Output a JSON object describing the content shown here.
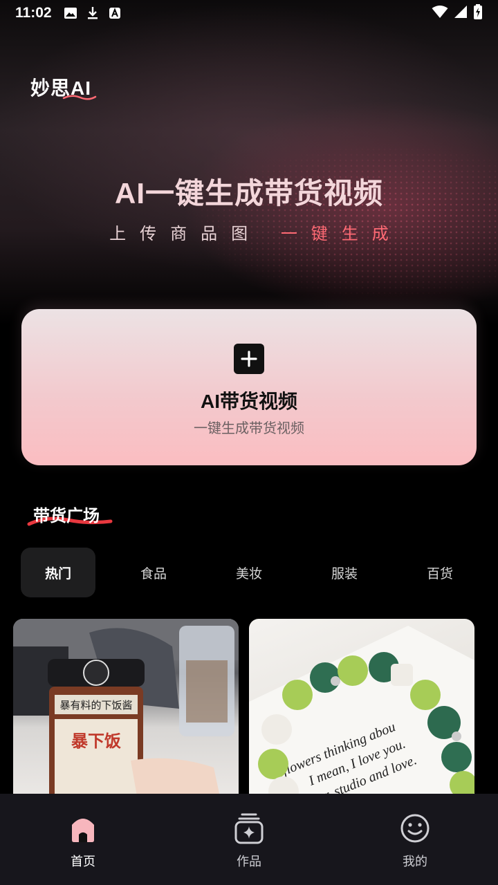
{
  "status_bar": {
    "time": "11:02"
  },
  "app": {
    "logo": "妙思AI"
  },
  "hero": {
    "title": "AI一键生成带货视频",
    "subtitle_part1": "上传商品图",
    "subtitle_part2": "一键生成"
  },
  "create_card": {
    "title": "AI带货视频",
    "subtitle": "一键生成带货视频"
  },
  "plaza": {
    "title": "带货广场",
    "tabs": [
      "热门",
      "食品",
      "美妆",
      "服装",
      "百货"
    ],
    "active_tab": "热门",
    "products": [
      {
        "image_label": "暴有料的下饭酱",
        "brand": "暴下饭"
      },
      {
        "image_text_lines": [
          "flowers thinking abou",
          "I mean, I love you.",
          "ower, studio and love."
        ]
      }
    ]
  },
  "bottom_nav": {
    "items": [
      {
        "label": "首页",
        "icon": "home-icon",
        "active": true
      },
      {
        "label": "作品",
        "icon": "works-icon",
        "active": false
      },
      {
        "label": "我的",
        "icon": "profile-smile-icon",
        "active": false
      }
    ]
  },
  "colors": {
    "accent_red": "#ff6a74",
    "card_pink": "#fbbdc1",
    "nav_bg": "#17161c"
  }
}
